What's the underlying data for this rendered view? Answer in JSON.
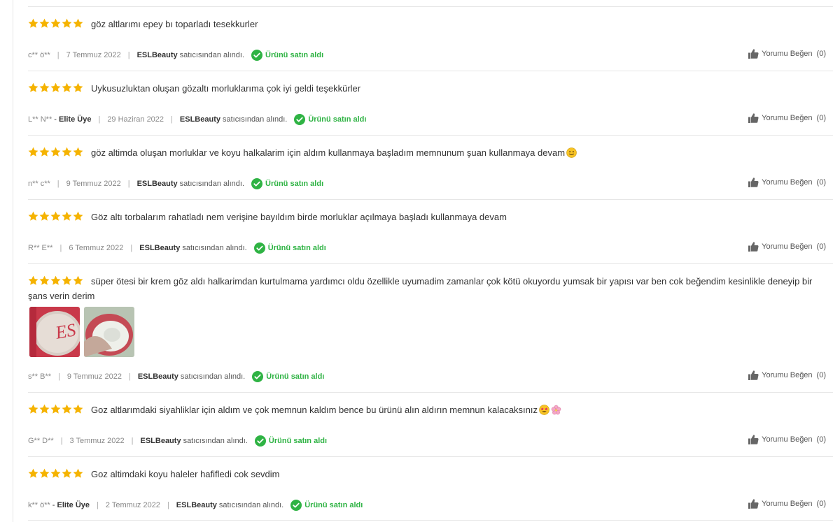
{
  "colors": {
    "star": "#f5b301",
    "verified": "#2fb344",
    "border": "#e6e6e6"
  },
  "icons": {
    "star": "star-icon",
    "check": "check-circle-icon",
    "like": "thumbs-up-icon"
  },
  "like_label": "Yorumu Beğen",
  "seller_suffix": "satıcısından alındı.",
  "verified_label": "Ürünü satın aldı",
  "reviews": [
    {
      "rating": 5,
      "comment": "göz altlarımı epey bı toparladı tesekkurler",
      "user": "c** ö**",
      "elite": "",
      "date": "7 Temmuz 2022",
      "seller": "ESLBeauty",
      "likes": "(0)",
      "emoji": []
    },
    {
      "rating": 5,
      "comment": "Uykusuzluktan oluşan gözaltı morluklarıma çok iyi geldi teşekkürler",
      "user": "L** N**",
      "elite": "Elite Üye",
      "date": "29 Haziran 2022",
      "seller": "ESLBeauty",
      "likes": "(0)",
      "emoji": []
    },
    {
      "rating": 5,
      "comment": "göz altimda oluşan morluklar ve koyu halkalarim için aldım kullanmaya başladım memnunum şuan kullanmaya devam",
      "user": "n** c**",
      "elite": "",
      "date": "9 Temmuz 2022",
      "seller": "ESLBeauty",
      "likes": "(0)",
      "emoji": [
        "smiling-face-emoji"
      ]
    },
    {
      "rating": 5,
      "comment": "Göz altı torbalarım rahatladı nem verişine bayıldım birde morluklar açılmaya başladı kullanmaya devam",
      "user": "R** E**",
      "elite": "",
      "date": "6 Temmuz 2022",
      "seller": "ESLBeauty",
      "likes": "(0)",
      "emoji": []
    },
    {
      "rating": 5,
      "comment": "süper ötesi bir krem göz aldı halkarimdan kurtulmama yardımcı oldu özellikle uyumadim zamanlar çok kötü okuyordu yumsak bir yapısı var ben cok beğendim kesinlikle deneyip bir şans verin derim",
      "user": "s** B**",
      "elite": "",
      "date": "9 Temmuz 2022",
      "seller": "ESLBeauty",
      "likes": "(0)",
      "emoji": [],
      "photos": [
        "product-jar-lid-photo",
        "product-cream-photo"
      ]
    },
    {
      "rating": 5,
      "comment": "Goz altlarımdaki siyahliklar için aldım ve çok memnun kaldım bence bu ürünü alın aldırın memnun kalacaksınız",
      "user": "G** D**",
      "elite": "",
      "date": "3 Temmuz 2022",
      "seller": "ESLBeauty",
      "likes": "(0)",
      "emoji": [
        "star-struck-emoji",
        "cherry-blossom-emoji"
      ]
    },
    {
      "rating": 5,
      "comment": "Goz altimdaki koyu haleler hafifledi cok sevdim",
      "user": "k** ö**",
      "elite": "Elite Üye",
      "date": "2 Temmuz 2022",
      "seller": "ESLBeauty",
      "likes": "(0)",
      "emoji": []
    }
  ]
}
